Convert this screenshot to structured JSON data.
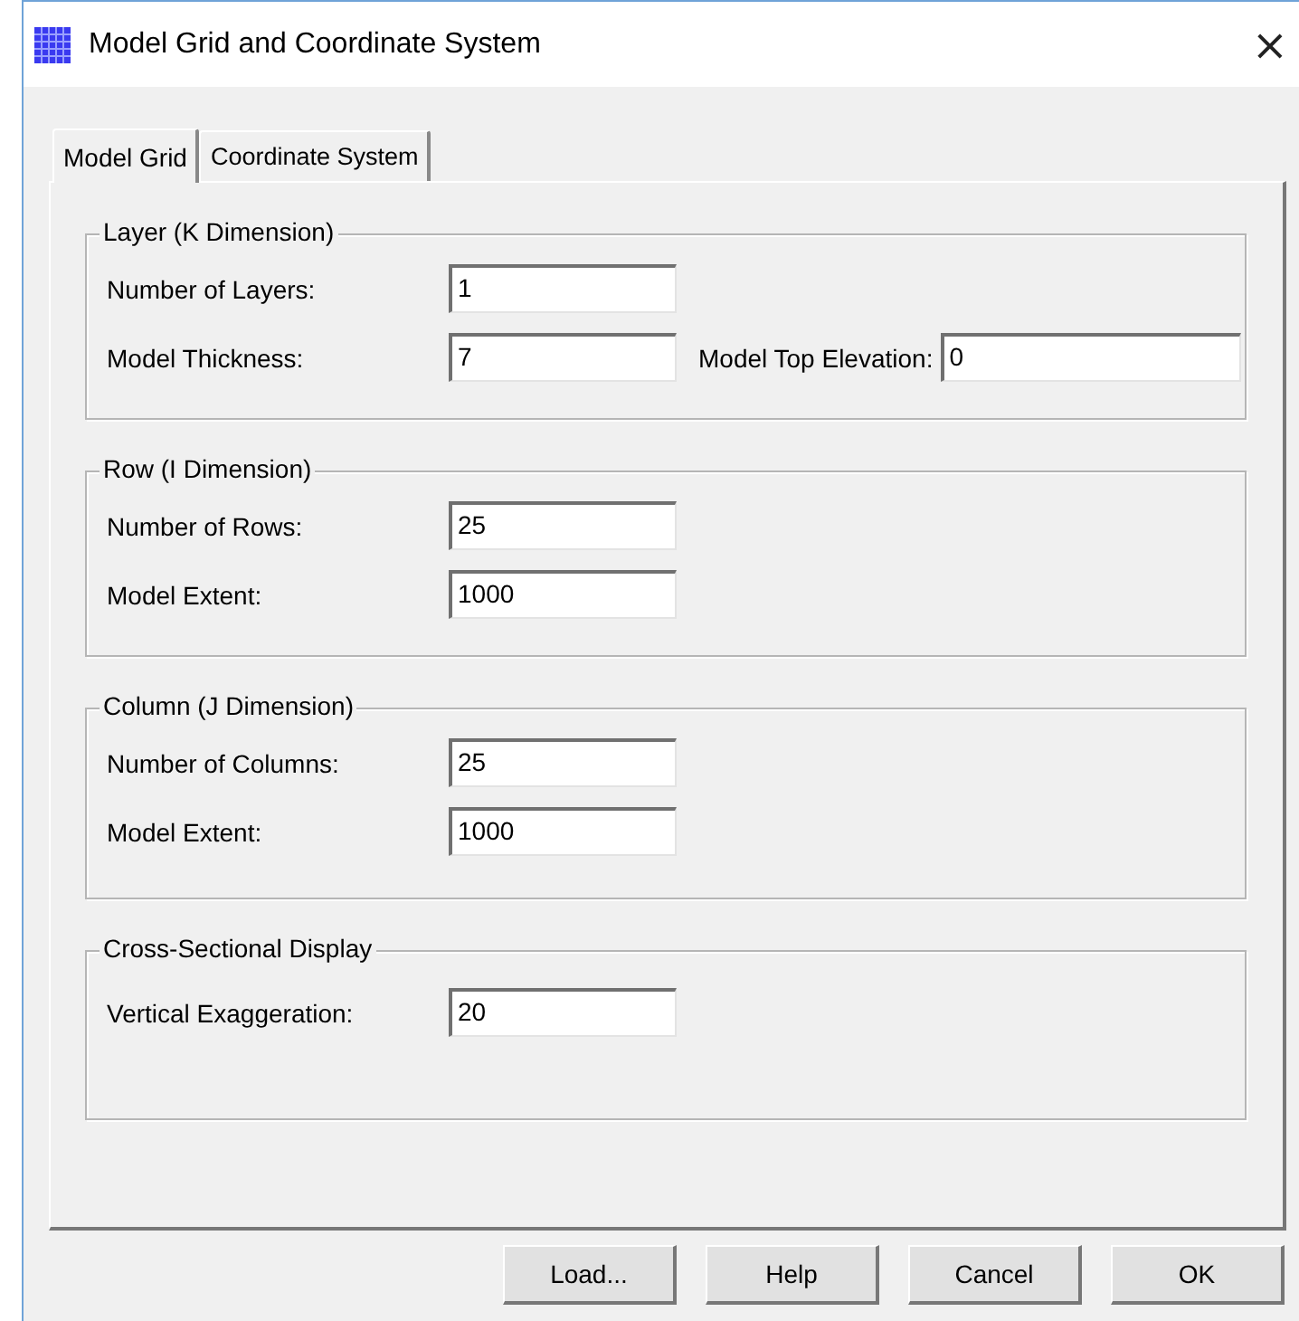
{
  "window": {
    "title": "Model Grid and Coordinate System",
    "close": "×"
  },
  "tabs": [
    {
      "label": "Model Grid",
      "selected": true
    },
    {
      "label": "Coordinate System",
      "selected": false
    }
  ],
  "groups": [
    {
      "title": "Layer (K Dimension)",
      "rows": [
        [
          {
            "label": "Number of Layers:",
            "value": "1"
          }
        ],
        [
          {
            "label": "Model Thickness:",
            "value": "7"
          },
          {
            "label": "Model Top Elevation:",
            "value": "0"
          }
        ]
      ]
    },
    {
      "title": "Row (I Dimension)",
      "rows": [
        [
          {
            "label": "Number of Rows:",
            "value": "25"
          }
        ],
        [
          {
            "label": "Model Extent:",
            "value": "1000"
          }
        ]
      ]
    },
    {
      "title": "Column (J Dimension)",
      "rows": [
        [
          {
            "label": "Number of Columns:",
            "value": "25"
          }
        ],
        [
          {
            "label": "Model Extent:",
            "value": "1000"
          }
        ]
      ]
    },
    {
      "title": "Cross-Sectional Display",
      "rows": [
        [
          {
            "label": "Vertical Exaggeration:",
            "value": "20"
          }
        ]
      ]
    }
  ],
  "buttons": [
    "Load...",
    "Help",
    "Cancel",
    "OK"
  ]
}
